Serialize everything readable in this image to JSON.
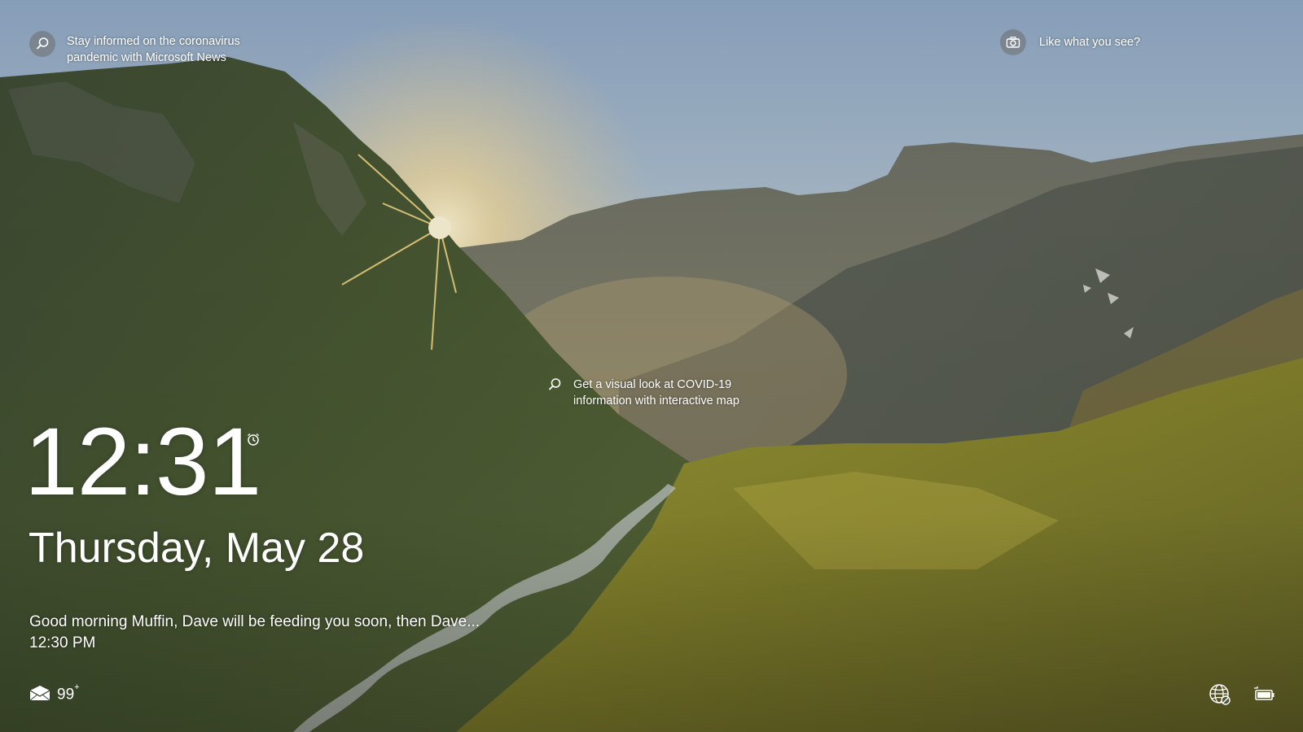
{
  "spotlight": {
    "top_left_tip": "Stay informed on the coronavirus pandemic with Microsoft News",
    "top_right_tip": "Like what you see?",
    "middle_tip": "Get a visual look at COVID-19 information with interactive map"
  },
  "lock": {
    "time": "12:31",
    "date": "Thursday, May 28"
  },
  "calendar": {
    "event_title": "Good morning Muffin, Dave will be feeding you soon, then Dave...",
    "event_time": "12:30 PM"
  },
  "status": {
    "mail_count": "99",
    "mail_suffix": "+"
  },
  "icons": {
    "top_left": "search-icon",
    "top_right": "camera-icon",
    "middle": "search-icon",
    "alarm": "alarm-icon",
    "mail": "mail-icon",
    "network": "network-globe-icon",
    "battery": "battery-icon"
  }
}
